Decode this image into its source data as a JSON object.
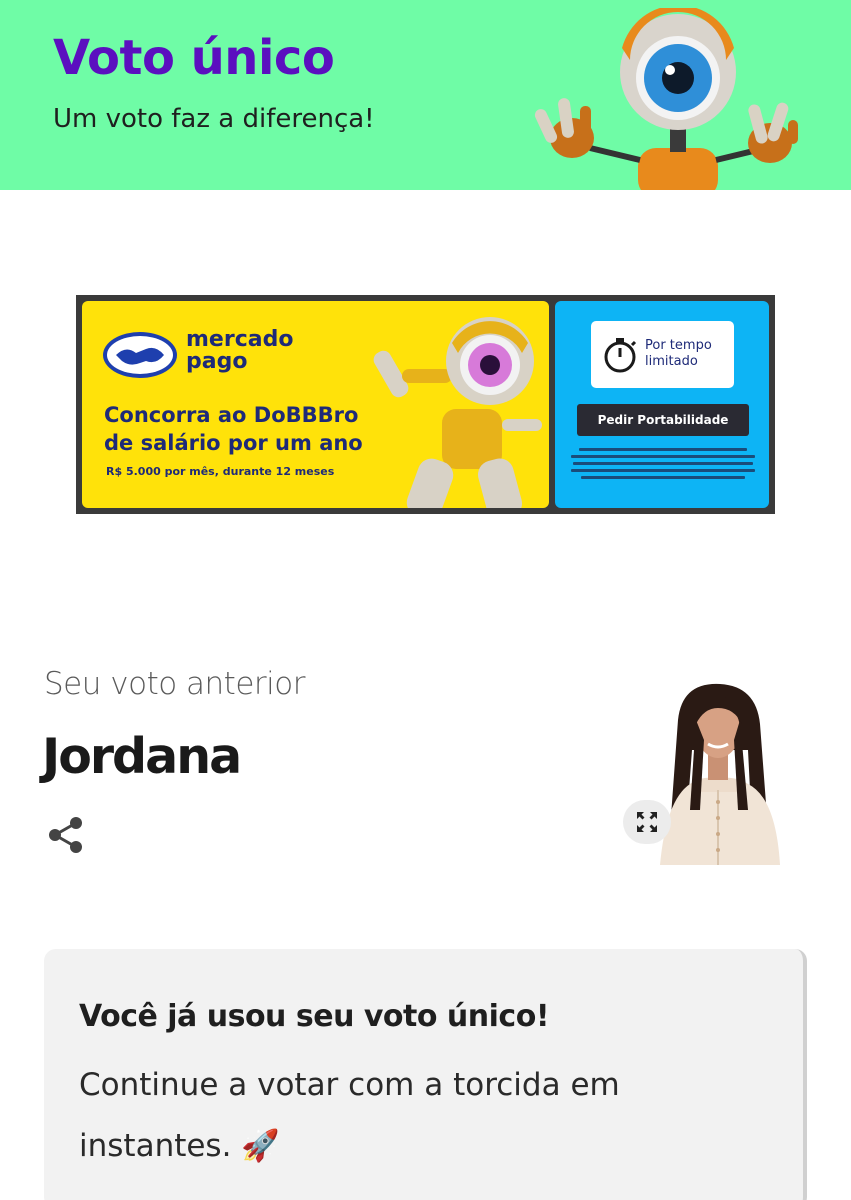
{
  "header": {
    "title": "Voto único",
    "subtitle": "Um voto faz a diferença!",
    "background": "#6ffca6",
    "title_color": "#5b0fbf"
  },
  "ad": {
    "brand": "mercado pago",
    "headline_line1": "Concorra ao DoBBBro",
    "headline_line2": "de salário por um ano",
    "fine_print": "R$ 5.000 por mês, durante 12 meses",
    "timer_label": "Por tempo limitado",
    "button_label": "Pedir Portabilidade",
    "left_bg": "#ffe20a",
    "right_bg": "#0db4f5"
  },
  "previous_vote": {
    "label": "Seu voto anterior",
    "name": "Jordana",
    "share_icon": "share-icon",
    "expand_icon": "expand-icon"
  },
  "notice": {
    "title": "Você já usou seu voto único!",
    "body": "Continue a votar com a torcida em instantes. 🚀"
  }
}
